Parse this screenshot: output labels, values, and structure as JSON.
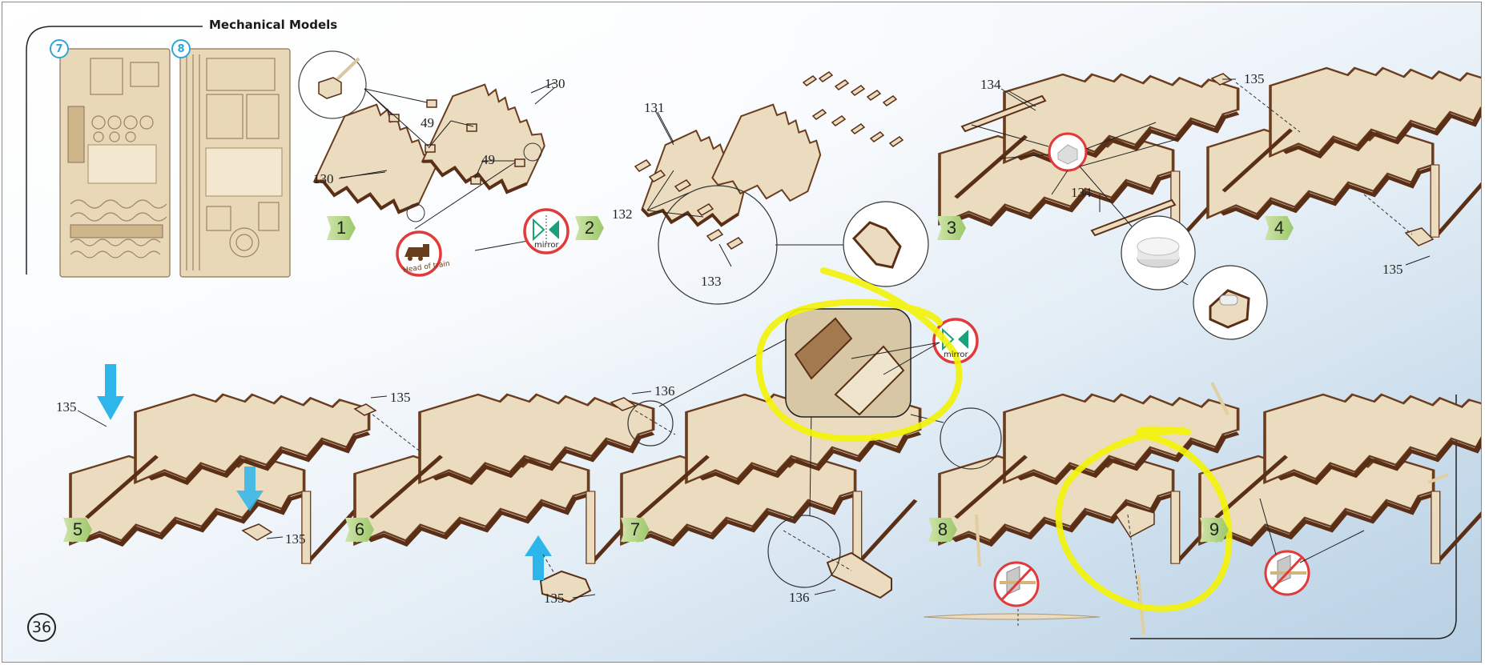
{
  "header": {
    "title": "Mechanical Models"
  },
  "sheets": [
    {
      "number": "7"
    },
    {
      "number": "8"
    }
  ],
  "steps": [
    "1",
    "2",
    "3",
    "4",
    "5",
    "6",
    "7",
    "8",
    "9"
  ],
  "part_labels": {
    "p130a": "130",
    "p130b": "130",
    "p49a": "49",
    "p49b": "49",
    "p131": "131",
    "p132": "132",
    "p133": "133",
    "p134a": "134",
    "p134b": "134",
    "p135a": "135",
    "p135b": "135",
    "p135c": "135",
    "p135d": "135",
    "p135e": "135",
    "p135f": "135",
    "p136a": "136",
    "p136b": "136"
  },
  "icons": {
    "mirror_a": "mirror",
    "mirror_b": "mirror",
    "head_of_train": "Head of train"
  },
  "page_number": "36",
  "colors": {
    "wood": "#ecdcbf",
    "wood_dark": "#6b3d1f",
    "highlight": "#f2f20a",
    "arrow": "#2eb5ea",
    "red_ring": "#e03a3a",
    "step_green": "#9cc86a"
  }
}
